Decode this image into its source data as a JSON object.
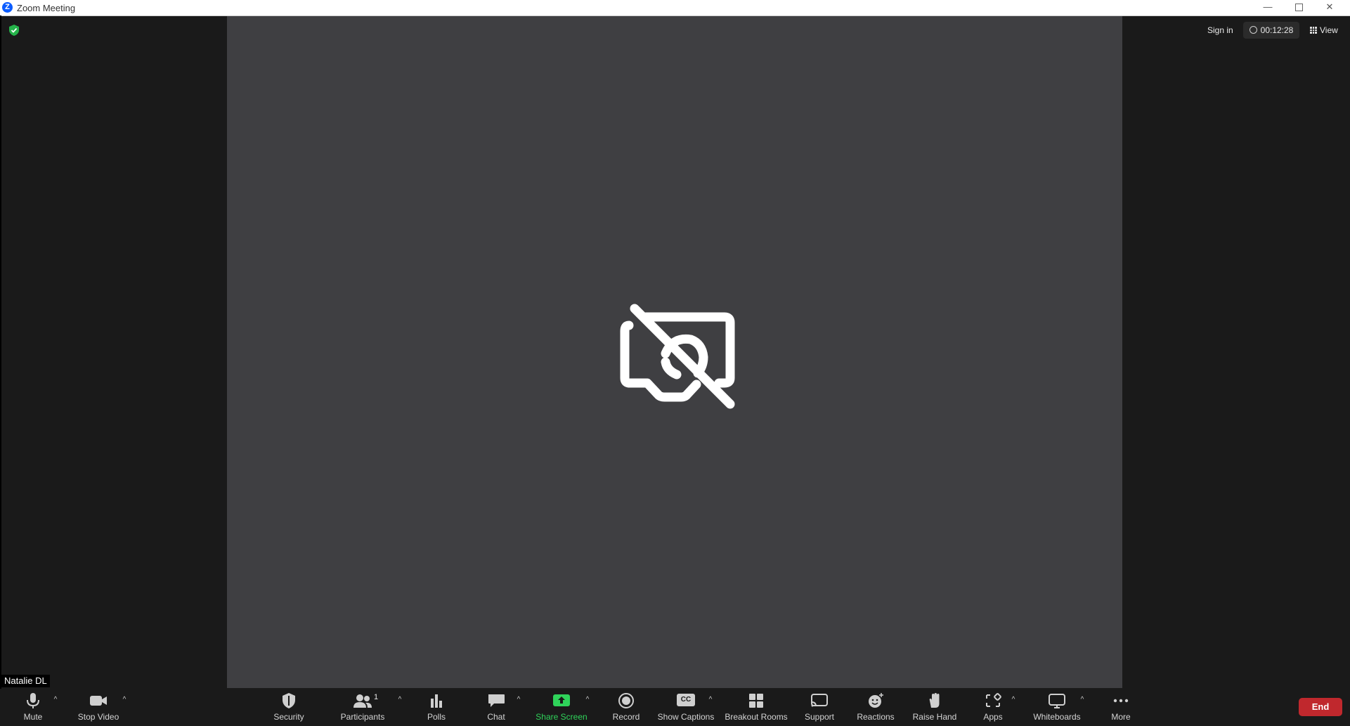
{
  "window": {
    "title": "Zoom Meeting",
    "app_icon": "Z",
    "minimize": "—",
    "close": "✕"
  },
  "top_right": {
    "sign_in": "Sign in",
    "timer": "00:12:28",
    "view": "View"
  },
  "participant": {
    "name": "Natalie DL",
    "video_state": "video-off-icon"
  },
  "toolbar": {
    "mute": "Mute",
    "stop_video": "Stop Video",
    "security": "Security",
    "participants": "Participants",
    "participants_count": "1",
    "polls": "Polls",
    "chat": "Chat",
    "share_screen": "Share Screen",
    "record": "Record",
    "show_captions": "Show Captions",
    "captions_icon_text": "CC",
    "breakout_rooms": "Breakout Rooms",
    "support": "Support",
    "reactions": "Reactions",
    "raise_hand": "Raise Hand",
    "apps": "Apps",
    "whiteboards": "Whiteboards",
    "more": "More",
    "end": "End",
    "caret": "^"
  },
  "colors": {
    "background": "#1a1a1a",
    "stage": "#3f3f42",
    "accent_green": "#2fd35a",
    "end_red": "#c0282d",
    "brand_blue": "#0b5cff"
  }
}
